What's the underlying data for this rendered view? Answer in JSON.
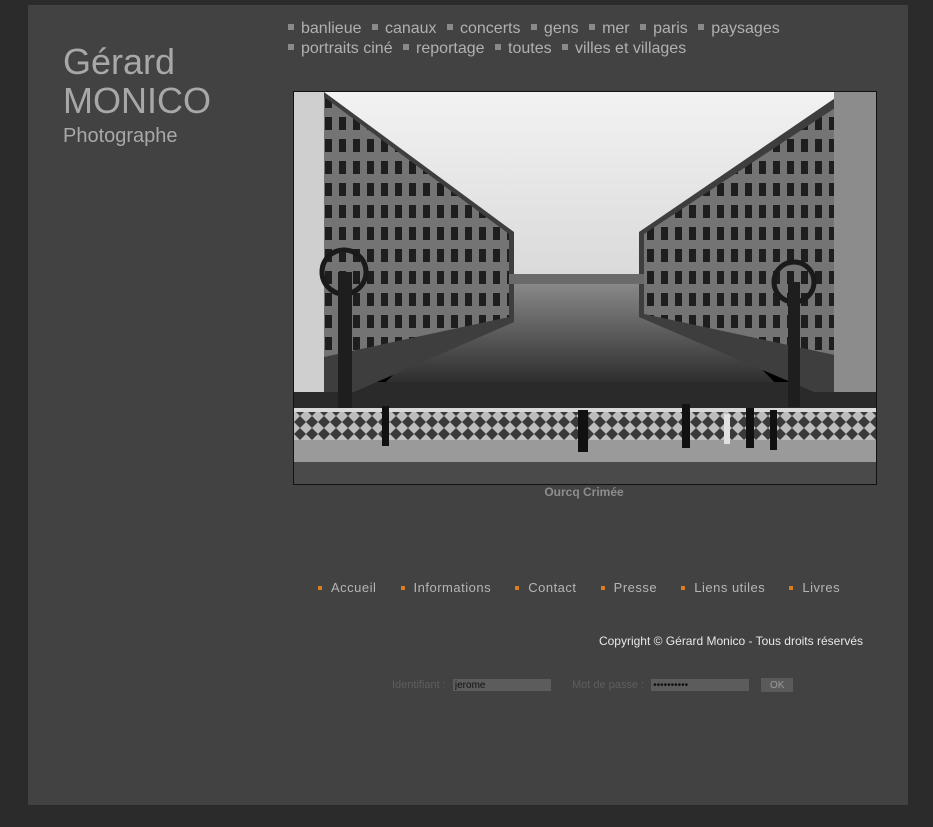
{
  "brand": {
    "first_name": "Gérard",
    "last_name": "MONICO",
    "role": "Photographe"
  },
  "categories": [
    "banlieue",
    "canaux",
    "concerts",
    "gens",
    "mer",
    "paris",
    "paysages",
    "portraits ciné",
    "reportage",
    "toutes",
    "villes et villages"
  ],
  "photo": {
    "caption": "Ourcq Crimée"
  },
  "footer_nav": [
    "Accueil",
    "Informations",
    "Contact",
    "Presse",
    "Liens utiles",
    "Livres"
  ],
  "copyright": "Copyright © Gérard Monico - Tous droits réservés",
  "login": {
    "id_label": "Identifiant :",
    "id_value": "jerome",
    "pw_label": "Mot de passe :",
    "pw_value": "••••••••••",
    "ok_label": "OK"
  },
  "colors": {
    "outer_bg": "#2b2b2b",
    "page_bg": "#424242",
    "accent_bullet": "#e07b1e"
  }
}
